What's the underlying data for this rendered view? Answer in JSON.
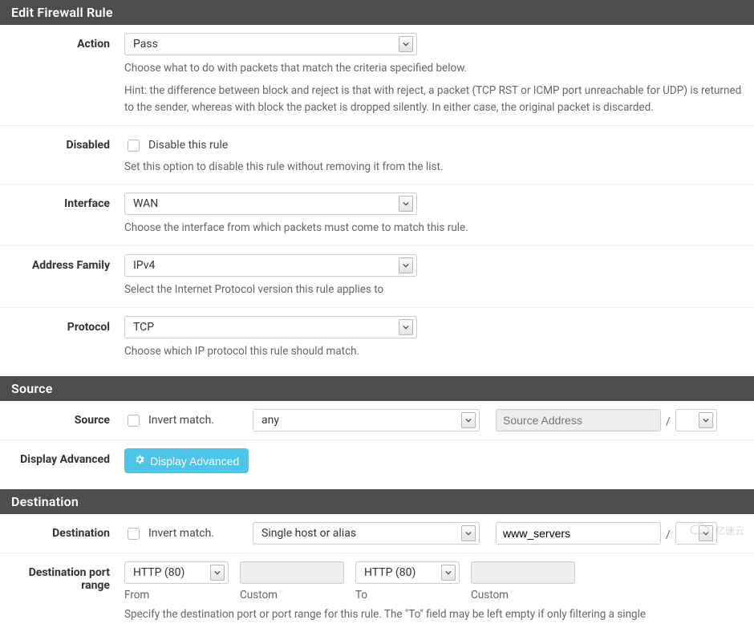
{
  "sections": {
    "edit": {
      "heading": "Edit Firewall Rule",
      "action": {
        "label": "Action",
        "value": "Pass",
        "help1": "Choose what to do with packets that match the criteria specified below.",
        "help2": "Hint: the difference between block and reject is that with reject, a packet (TCP RST or ICMP port unreachable for UDP) is returned to the sender, whereas with block the packet is dropped silently. In either case, the original packet is discarded."
      },
      "disabled": {
        "label": "Disabled",
        "checkbox_label": "Disable this rule",
        "help": "Set this option to disable this rule without removing it from the list."
      },
      "interface": {
        "label": "Interface",
        "value": "WAN",
        "help": "Choose the interface from which packets must come to match this rule."
      },
      "addrfam": {
        "label": "Address Family",
        "value": "IPv4",
        "help": "Select the Internet Protocol version this rule applies to"
      },
      "protocol": {
        "label": "Protocol",
        "value": "TCP",
        "help": "Choose which IP protocol this rule should match."
      }
    },
    "source": {
      "heading": "Source",
      "row_label": "Source",
      "invert_label": "Invert match.",
      "type_value": "any",
      "addr_placeholder": "Source Address",
      "slash": "/",
      "display_adv_label": "Display Advanced",
      "display_adv_button": "Display Advanced"
    },
    "destination": {
      "heading": "Destination",
      "row_label": "Destination",
      "invert_label": "Invert match.",
      "type_value": "Single host or alias",
      "addr_value": "www_servers",
      "slash": "/",
      "port": {
        "label": "Destination port range",
        "from_val": "HTTP (80)",
        "from_label": "From",
        "from_custom_label": "Custom",
        "to_val": "HTTP (80)",
        "to_label": "To",
        "to_custom_label": "Custom",
        "help": "Specify the destination port or port range for this rule. The \"To\" field may be left empty if only filtering a single"
      }
    }
  },
  "watermark": "亿速云"
}
